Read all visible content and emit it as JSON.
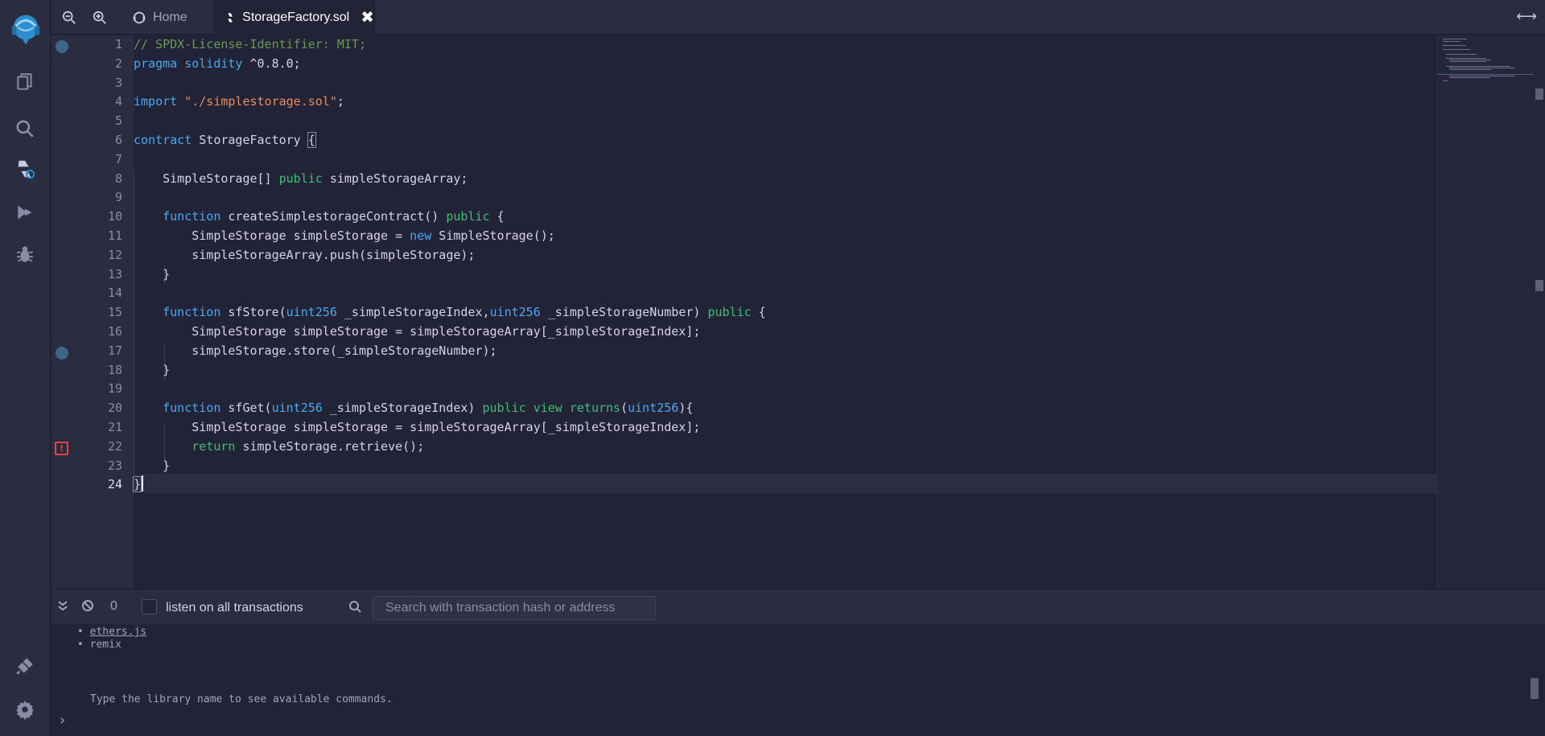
{
  "sidebar": {
    "icons": [
      "remix-logo-icon",
      "file-explorer-icon",
      "search-icon",
      "solidity-compiler-icon",
      "deploy-run-icon",
      "debugger-icon",
      "plugin-manager-icon",
      "settings-icon"
    ]
  },
  "tabs": {
    "home_label": "Home",
    "file_label": "StorageFactory.sol",
    "close_glyph": "✖"
  },
  "editor": {
    "active_line": 24,
    "line_numbers": [
      "1",
      "2",
      "3",
      "4",
      "5",
      "6",
      "7",
      "8",
      "9",
      "10",
      "11",
      "12",
      "13",
      "14",
      "15",
      "16",
      "17",
      "18",
      "19",
      "20",
      "21",
      "22",
      "23",
      "24"
    ],
    "lines": [
      [
        [
          "c",
          "// SPDX-License-Identifier: MIT;"
        ]
      ],
      [
        [
          "k",
          "pragma"
        ],
        [
          "p",
          " "
        ],
        [
          "k",
          "solidity"
        ],
        [
          "p",
          " ^0.8.0;"
        ]
      ],
      [],
      [
        [
          "k",
          "import"
        ],
        [
          "p",
          " "
        ],
        [
          "s",
          "\"./simplestorage.sol\""
        ],
        [
          "p",
          ";"
        ]
      ],
      [],
      [
        [
          "k",
          "contract"
        ],
        [
          "p",
          " StorageFactory "
        ],
        [
          "b",
          "{"
        ]
      ],
      [],
      [
        [
          "p",
          "    SimpleStorage[] "
        ],
        [
          "g",
          "public"
        ],
        [
          "p",
          " simpleStorageArray;"
        ]
      ],
      [],
      [
        [
          "p",
          "    "
        ],
        [
          "k",
          "function"
        ],
        [
          "p",
          " createSimplestorageContract() "
        ],
        [
          "g",
          "public"
        ],
        [
          "p",
          " {"
        ]
      ],
      [
        [
          "p",
          "        SimpleStorage simpleStorage = "
        ],
        [
          "k",
          "new"
        ],
        [
          "p",
          " SimpleStorage();"
        ]
      ],
      [
        [
          "p",
          "        simpleStorageArray.push(simpleStorage);"
        ]
      ],
      [
        [
          "p",
          "    }"
        ]
      ],
      [],
      [
        [
          "p",
          "    "
        ],
        [
          "k",
          "function"
        ],
        [
          "p",
          " sfStore("
        ],
        [
          "k",
          "uint256"
        ],
        [
          "p",
          " _simpleStorageIndex,"
        ],
        [
          "k",
          "uint256"
        ],
        [
          "p",
          " _simpleStorageNumber) "
        ],
        [
          "g",
          "public"
        ],
        [
          "p",
          " {"
        ]
      ],
      [
        [
          "p",
          "        SimpleStorage simpleStorage = simpleStorageArray[_simpleStorageIndex];"
        ]
      ],
      [
        [
          "p",
          "        simpleStorage.store(_simpleStorageNumber);"
        ]
      ],
      [
        [
          "p",
          "    }"
        ]
      ],
      [],
      [
        [
          "p",
          "    "
        ],
        [
          "k",
          "function"
        ],
        [
          "p",
          " sfGet("
        ],
        [
          "k",
          "uint256"
        ],
        [
          "p",
          " _simpleStorageIndex) "
        ],
        [
          "g",
          "public"
        ],
        [
          "p",
          " "
        ],
        [
          "g",
          "view"
        ],
        [
          "p",
          " "
        ],
        [
          "g",
          "returns"
        ],
        [
          "p",
          "("
        ],
        [
          "k",
          "uint256"
        ],
        [
          "p",
          "){"
        ]
      ],
      [
        [
          "p",
          "        SimpleStorage simpleStorage = simpleStorageArray[_simpleStorageIndex];"
        ]
      ],
      [
        [
          "p",
          "        "
        ],
        [
          "g",
          "return"
        ],
        [
          "p",
          " simpleStorage.retrieve();"
        ]
      ],
      [
        [
          "p",
          "    }"
        ]
      ],
      [
        [
          "b",
          "}"
        ]
      ]
    ],
    "error_glyph": "!"
  },
  "terminal": {
    "tx_count": "0",
    "listen_label": "listen on all transactions",
    "search_placeholder": "Search with transaction hash or address",
    "libraries": [
      "ethers.js",
      "remix"
    ],
    "hint": "Type the library name to see available commands.",
    "prompt": "›"
  },
  "colors": {
    "background": "#222336",
    "panel": "#2a2c3f",
    "keyword": "#4aa8f0",
    "keyword_green": "#3cbf72",
    "string": "#e88c5e",
    "comment": "#6a9955",
    "error": "#e4424f"
  }
}
